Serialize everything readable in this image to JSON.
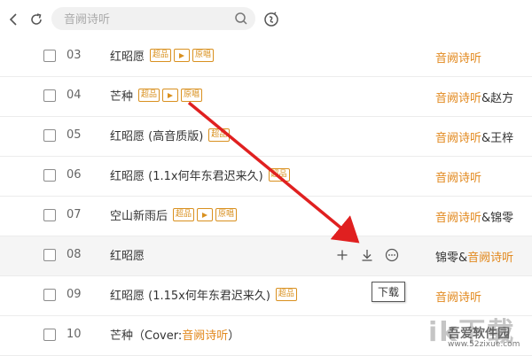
{
  "search": {
    "placeholder": "音阙诗听"
  },
  "tags": {
    "sq": "超品",
    "mv": "▶",
    "original": "原唱"
  },
  "rows": [
    {
      "num": "03",
      "title": "红昭愿",
      "artist_hl": "音阙诗听",
      "artist_rest": ""
    },
    {
      "num": "04",
      "title": "芒种",
      "artist_hl": "音阙诗听",
      "artist_rest": "&赵方"
    },
    {
      "num": "05",
      "title": "红昭愿 (高音质版)",
      "artist_hl": "音阙诗听",
      "artist_rest": "&王梓"
    },
    {
      "num": "06",
      "title": "红昭愿 (1.1x何年东君迟来久)",
      "artist_hl": "音阙诗听",
      "artist_rest": ""
    },
    {
      "num": "07",
      "title": "空山新雨后",
      "artist_hl": "音阙诗听",
      "artist_rest": "&锦零"
    },
    {
      "num": "08",
      "title": "红昭愿",
      "artist_pre": "锦零&",
      "artist_hl": "音阙诗听"
    },
    {
      "num": "09",
      "title": "红昭愿 (1.15x何年东君迟来久)",
      "artist_hl": "音阙诗听",
      "artist_rest": ""
    },
    {
      "num": "10",
      "title_pre": "芒种（Cover: ",
      "title_hl": "音阙诗听",
      "title_post": "）"
    }
  ],
  "tooltip": {
    "download": "下载"
  },
  "watermark": {
    "big": "ik下载",
    "name": "吾爱软件园",
    "url": "www.52zixue.com"
  },
  "colors": {
    "accent": "#e2891e",
    "arrow": "#e02020"
  },
  "icons": [
    "back-icon",
    "refresh-icon",
    "search-icon",
    "shazam-icon",
    "add-icon",
    "download-icon",
    "more-icon",
    "mv-badge-icon"
  ]
}
